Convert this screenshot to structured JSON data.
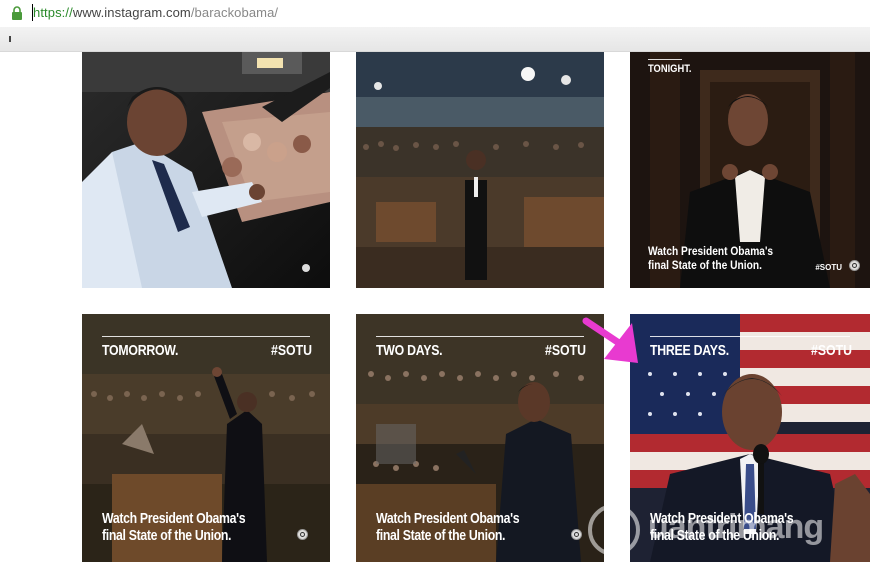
{
  "address_bar": {
    "scheme": "https://",
    "host": "www.instagram.com",
    "path": "/barackobama/"
  },
  "posts": [
    {
      "id": "post-1"
    },
    {
      "id": "post-2"
    },
    {
      "id": "post-3",
      "headline": "TONIGHT.",
      "caption_line1": "Watch President Obama's",
      "caption_line2": "final State of the Union.",
      "hashtag": "#SOTU"
    },
    {
      "id": "post-4",
      "headline": "TOMORROW.",
      "hashtag": "#SOTU",
      "caption_line1": "Watch President Obama's",
      "caption_line2": "final State of the Union."
    },
    {
      "id": "post-5",
      "headline": "TWO DAYS.",
      "hashtag": "#SOTU",
      "caption_line1": "Watch President Obama's",
      "caption_line2": "final State of the Union."
    },
    {
      "id": "post-6",
      "headline": "THREE DAYS.",
      "hashtag": "#SOTU",
      "caption_line1": "Watch President Obama's",
      "caption_line2": "final State of the Union."
    }
  ],
  "watermark": {
    "text": "uantrimang"
  },
  "colors": {
    "arrow": "#e83ad0",
    "url_scheme": "#2a8a2a",
    "url_path": "#888888"
  }
}
